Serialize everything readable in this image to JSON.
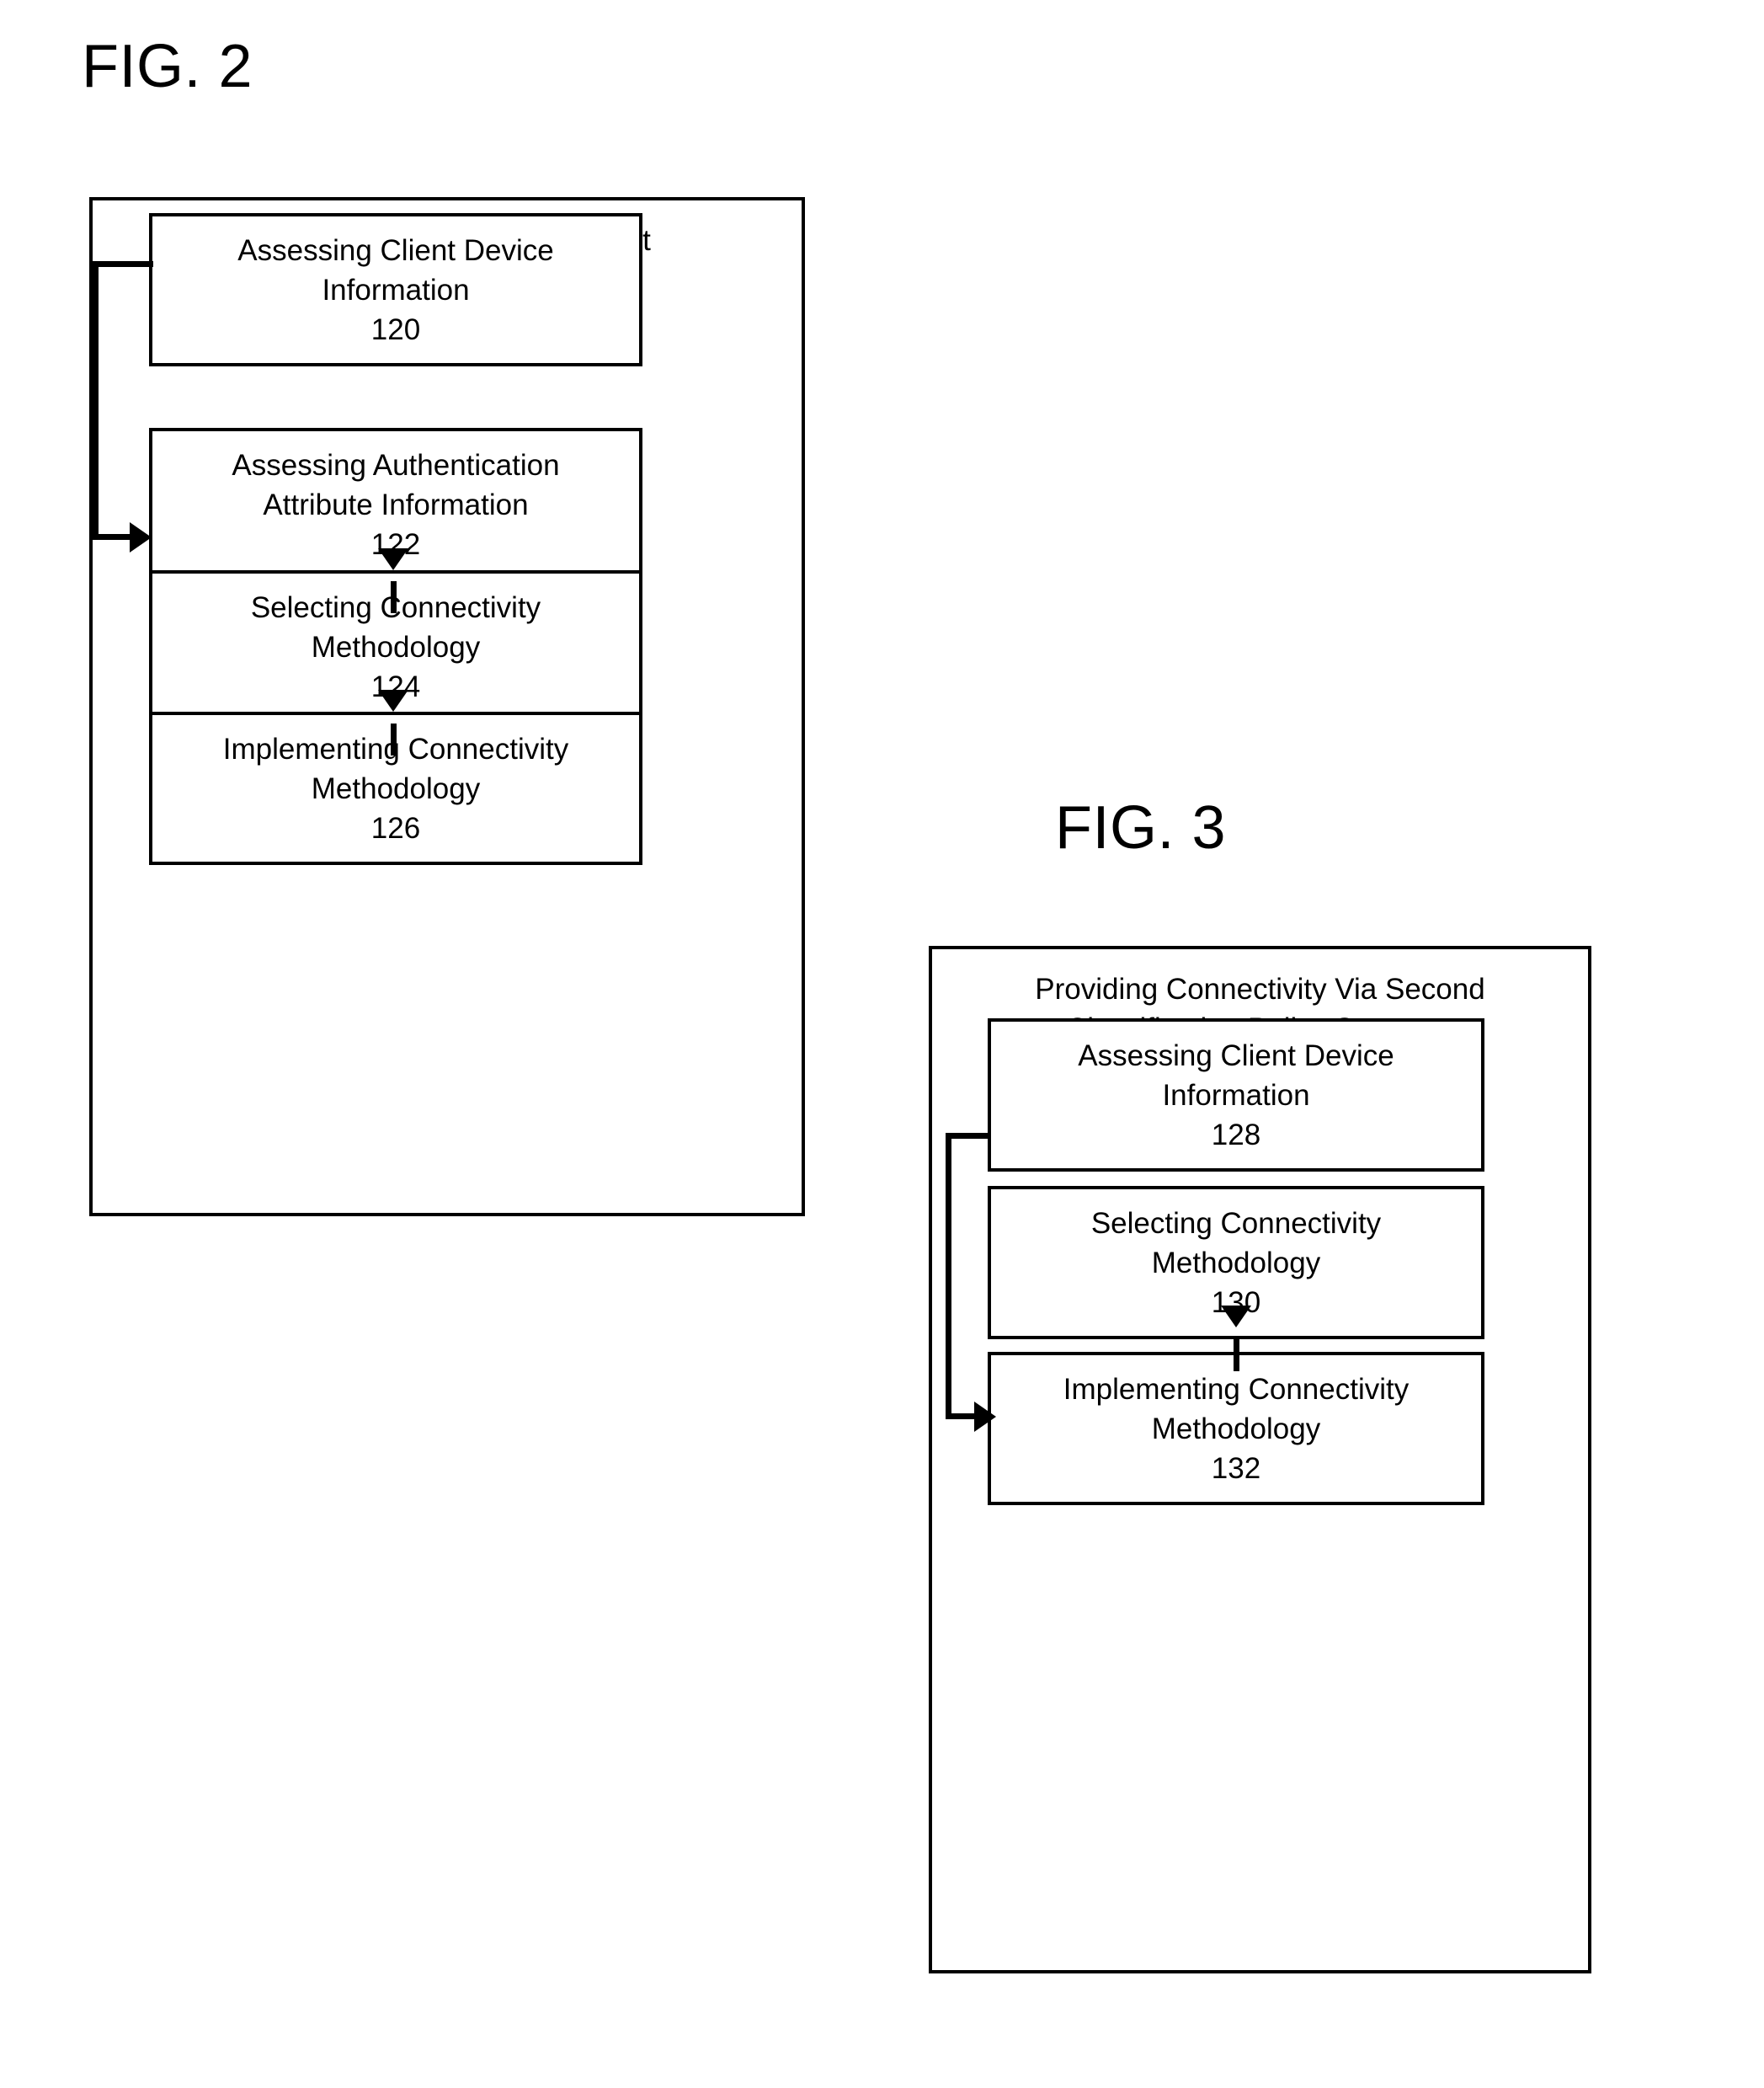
{
  "figures": [
    {
      "label": "FIG. 2",
      "title": "Providing Connectivity Via First\nClassification Policy Structure",
      "steps": [
        {
          "text": "Assessing Client Device\nInformation",
          "number": "120"
        },
        {
          "text": "Assessing Authentication\nAttribute Information",
          "number": "122"
        },
        {
          "text": "Selecting Connectivity\nMethodology",
          "number": "124"
        },
        {
          "text": "Implementing Connectivity\nMethodology",
          "number": "126"
        }
      ],
      "connectors": [
        {
          "type": "arrow-down",
          "from": "122",
          "to": "124"
        },
        {
          "type": "arrow-down",
          "from": "124",
          "to": "126"
        },
        {
          "type": "feedback-loop",
          "from": "120",
          "to": "124"
        }
      ]
    },
    {
      "label": "FIG. 3",
      "title": "Providing Connectivity Via Second\nClassification Policy Structure",
      "steps": [
        {
          "text": "Assessing Client Device\nInformation",
          "number": "128"
        },
        {
          "text": "Selecting Connectivity\nMethodology",
          "number": "130"
        },
        {
          "text": "Implementing Connectivity\nMethodology",
          "number": "132"
        }
      ],
      "connectors": [
        {
          "type": "arrow-down",
          "from": "130",
          "to": "132"
        },
        {
          "type": "feedback-loop",
          "from": "128",
          "to": "132"
        }
      ]
    }
  ],
  "colors": {
    "line": "#000000",
    "background": "#ffffff",
    "text": "#000000"
  }
}
